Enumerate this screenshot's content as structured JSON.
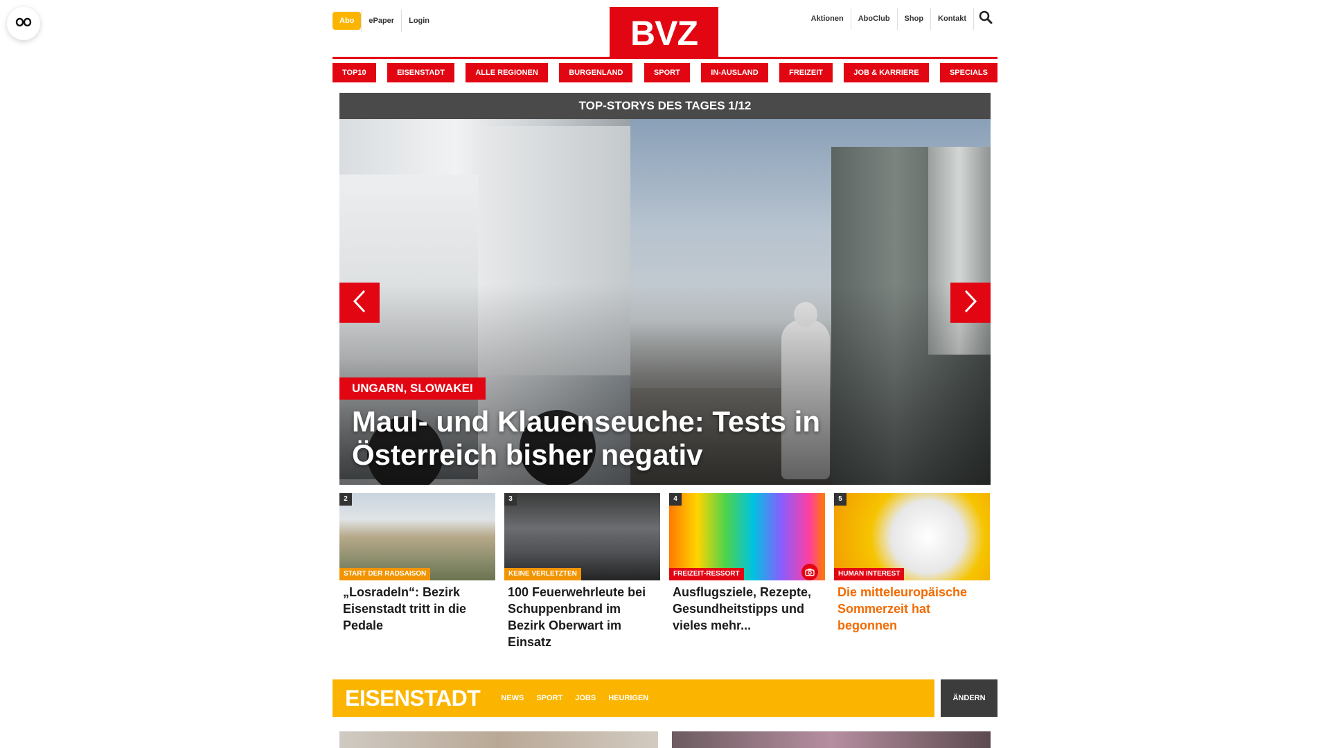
{
  "header": {
    "abo_label": "Abo",
    "left_links": [
      "ePaper",
      "Login"
    ],
    "logo_text": "BVZ",
    "right_links": [
      "Aktionen",
      "AboClub",
      "Shop",
      "Kontakt"
    ]
  },
  "nav": {
    "items": [
      "TOP10",
      "EISENSTADT",
      "ALLE REGIONEN",
      "BURGENLAND",
      "SPORT",
      "IN-AUSLAND",
      "FREIZEIT",
      "JOB & KARRIERE",
      "SPECIALS"
    ]
  },
  "top_stories": {
    "bar_label": "TOP-STORYS DES TAGES 1/12",
    "hero": {
      "tag": "UNGARN, SLOWAKEI",
      "title": "Maul- und Klauenseuche: Tests in Österreich bisher negativ"
    },
    "cards": [
      {
        "number": "2",
        "tag": "START DER RADSAISON",
        "headline": "„Losradeln“: Bezirk Eisenstadt tritt in die Pedale"
      },
      {
        "number": "3",
        "tag": "KEINE VERLETZTEN",
        "headline": "100 Feuerwehrleute bei Schuppenbrand im Bezirk Oberwart im Einsatz"
      },
      {
        "number": "4",
        "tag": "FREIZEIT-RESSORT",
        "headline": "Ausflugsziele, Rezepte, Gesundheitstipps und vieles mehr..."
      },
      {
        "number": "5",
        "tag": "HUMAN INTEREST",
        "headline": "Die mitteleuropäische Sommerzeit hat begonnen"
      }
    ]
  },
  "region": {
    "title": "EISENSTADT",
    "links": [
      "NEWS",
      "SPORT",
      "JOBS",
      "HEURIGEN"
    ],
    "change_label": "ÄNDERN"
  },
  "colors": {
    "brand_red": "#e20613",
    "abo_yellow": "#fbb500",
    "tag_orange": "#f29400",
    "headline_orange": "#f26b00",
    "dark_bar": "#4a4a4a"
  },
  "icons": [
    "reader-mode-icon",
    "search-icon",
    "chevron-left-icon",
    "chevron-right-icon",
    "camera-icon"
  ]
}
